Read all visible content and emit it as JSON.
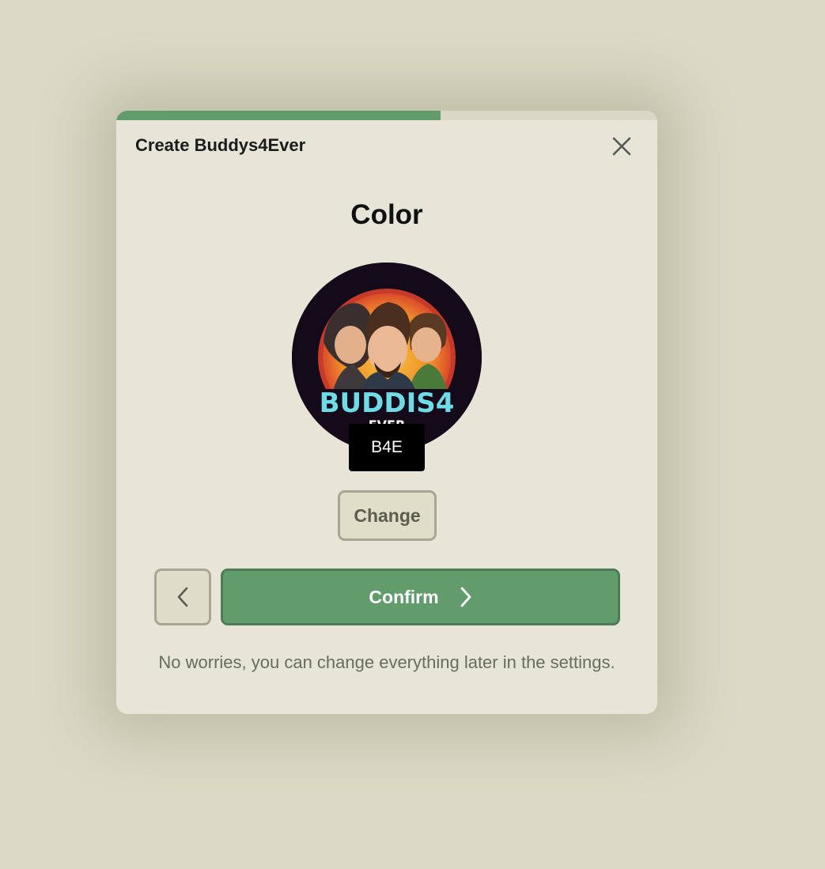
{
  "modal": {
    "title": "Create Buddys4Ever",
    "progress_fraction": 0.6,
    "close_icon": "close-icon"
  },
  "step": {
    "heading": "Color"
  },
  "avatar": {
    "logo_text": "BUDDIS4",
    "logo_subtext": "EVER",
    "initials": "B4E"
  },
  "actions": {
    "change_label": "Change",
    "back_icon": "chevron-left-icon",
    "confirm_label": "Confirm",
    "confirm_icon": "chevron-right-icon"
  },
  "footer": {
    "note": "No worries, you can change everything later in the settings."
  },
  "colors": {
    "accent": "#629c6c",
    "background": "#dcdac6",
    "modal": "#e7e5d7"
  }
}
